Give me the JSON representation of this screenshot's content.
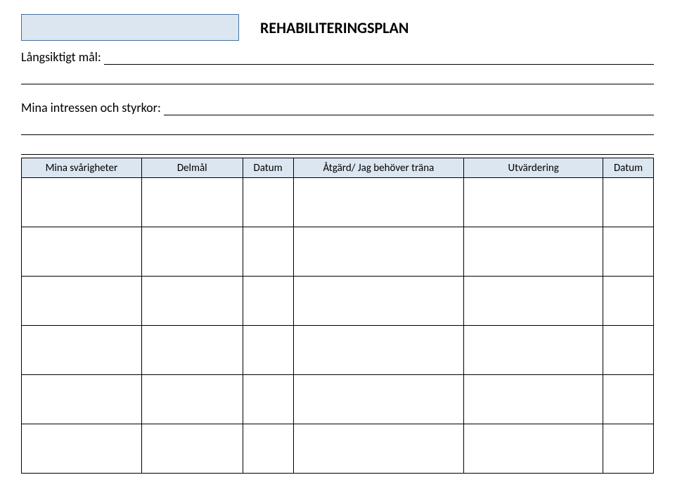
{
  "header": {
    "title": "REHABILITERINGSPLAN"
  },
  "fields": {
    "long_term_goal_label": "Långsiktigt mål:",
    "interests_label": "Mina intressen och styrkor:"
  },
  "table": {
    "headers": {
      "difficulties": "Mina svårigheter",
      "subgoal": "Delmål",
      "date1": "Datum",
      "action": "Åtgärd/ Jag behöver  träna",
      "evaluation": "Utvärdering",
      "date2": "Datum"
    },
    "rows": [
      {
        "difficulties": "",
        "subgoal": "",
        "date1": "",
        "action": "",
        "evaluation": "",
        "date2": ""
      },
      {
        "difficulties": "",
        "subgoal": "",
        "date1": "",
        "action": "",
        "evaluation": "",
        "date2": ""
      },
      {
        "difficulties": "",
        "subgoal": "",
        "date1": "",
        "action": "",
        "evaluation": "",
        "date2": ""
      },
      {
        "difficulties": "",
        "subgoal": "",
        "date1": "",
        "action": "",
        "evaluation": "",
        "date2": ""
      },
      {
        "difficulties": "",
        "subgoal": "",
        "date1": "",
        "action": "",
        "evaluation": "",
        "date2": ""
      },
      {
        "difficulties": "",
        "subgoal": "",
        "date1": "",
        "action": "",
        "evaluation": "",
        "date2": ""
      }
    ]
  }
}
